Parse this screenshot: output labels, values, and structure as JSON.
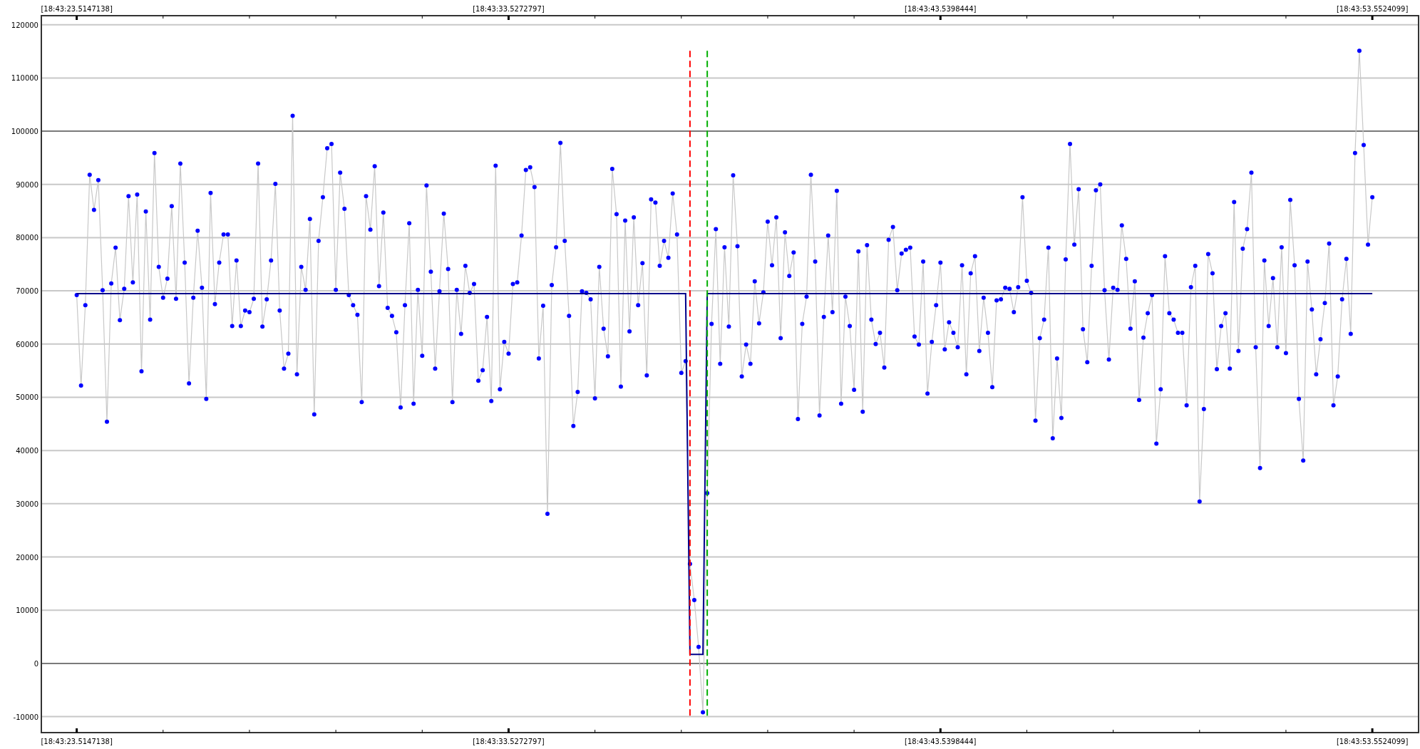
{
  "top_axis_labels": [
    "[18:43:23.5147138]",
    "[18:43:33.5272797]",
    "[18:43:43.5398444]",
    "[18:43:53.5524099]"
  ],
  "chart_data": {
    "type": "line",
    "grid": true,
    "ylim": [
      -13000,
      121700
    ],
    "categories": [
      "[18:43:23.5147138]",
      null,
      null,
      null,
      null,
      null,
      null,
      null,
      null,
      null,
      null,
      null,
      null,
      null,
      null,
      null,
      null,
      null,
      null,
      null,
      null,
      null,
      null,
      null,
      null,
      null,
      null,
      null,
      null,
      null,
      null,
      null,
      null,
      null,
      null,
      null,
      null,
      null,
      null,
      null,
      null,
      null,
      null,
      null,
      null,
      null,
      null,
      null,
      null,
      null,
      null,
      null,
      null,
      null,
      null,
      null,
      null,
      null,
      null,
      null,
      null,
      null,
      null,
      null,
      null,
      null,
      null,
      null,
      null,
      null,
      null,
      null,
      null,
      null,
      null,
      null,
      null,
      null,
      null,
      null,
      null,
      null,
      null,
      null,
      null,
      null,
      null,
      null,
      null,
      null,
      null,
      null,
      null,
      null,
      null,
      null,
      null,
      null,
      null,
      null,
      "[18:43:33.5272797]",
      null,
      null,
      null,
      null,
      null,
      null,
      null,
      null,
      null,
      null,
      null,
      null,
      null,
      null,
      null,
      null,
      null,
      null,
      null,
      null,
      null,
      null,
      null,
      null,
      null,
      null,
      null,
      null,
      null,
      null,
      null,
      null,
      null,
      null,
      null,
      null,
      null,
      null,
      null,
      null,
      null,
      null,
      null,
      null,
      null,
      null,
      null,
      null,
      null,
      null,
      null,
      null,
      null,
      null,
      null,
      null,
      null,
      null,
      null,
      null,
      null,
      null,
      null,
      null,
      null,
      null,
      null,
      null,
      null,
      null,
      null,
      null,
      null,
      null,
      null,
      null,
      null,
      null,
      null,
      null,
      null,
      null,
      null,
      null,
      null,
      null,
      null,
      null,
      null,
      null,
      null,
      null,
      null,
      null,
      null,
      null,
      null,
      null,
      null,
      "[18:43:43.5398444]",
      null,
      null,
      null,
      null,
      null,
      null,
      null,
      null,
      null,
      null,
      null,
      null,
      null,
      null,
      null,
      null,
      null,
      null,
      null,
      null,
      null,
      null,
      null,
      null,
      null,
      null,
      null,
      null,
      null,
      null,
      null,
      null,
      null,
      null,
      null,
      null,
      null,
      null,
      null,
      null,
      null,
      null,
      null,
      null,
      null,
      null,
      null,
      null,
      null,
      null,
      null,
      null,
      null,
      null,
      null,
      null,
      null,
      null,
      null,
      null,
      null,
      null,
      null,
      null,
      null,
      null,
      null,
      null,
      null,
      null,
      null,
      null,
      null,
      null,
      null,
      null,
      null,
      null,
      null,
      null,
      null,
      null,
      null,
      null,
      null,
      null,
      null,
      null,
      null,
      null,
      null,
      null,
      null,
      null,
      null,
      null,
      null,
      null,
      null,
      "[18:43:53.5524099]"
    ],
    "yticks": [
      -10000,
      0,
      10000,
      20000,
      30000,
      40000,
      50000,
      60000,
      70000,
      80000,
      90000,
      100000,
      110000,
      120000
    ],
    "series": [
      {
        "color": "#0000ff",
        "marker": "circle",
        "values": [
          69200,
          52200,
          67300,
          91800,
          85200,
          90800,
          70100,
          45400,
          71400,
          78100,
          64500,
          70400,
          87800,
          71600,
          88100,
          54900,
          84900,
          64600,
          95900,
          74500,
          68700,
          72300,
          85900,
          68500,
          93900,
          75300,
          52600,
          68700,
          81300,
          70600,
          49700,
          88400,
          67500,
          75300,
          80600,
          80600,
          63400,
          75700,
          63400,
          66300,
          66000,
          68500,
          93900,
          63300,
          68400,
          75700,
          90100,
          66300,
          55400,
          58200,
          102900,
          54300,
          74500,
          70200,
          83500,
          46800,
          79400,
          87600,
          96800,
          97600,
          70200,
          92200,
          85400,
          69200,
          67300,
          65500,
          49100,
          87800,
          81500,
          93400,
          70900,
          84700,
          66800,
          65300,
          62200,
          48100,
          67300,
          82700,
          48800,
          70200,
          57800,
          89800,
          73600,
          55400,
          69900,
          84500,
          74100,
          49100,
          70200,
          61900,
          74700,
          69600,
          71300,
          53100,
          55100,
          65100,
          49300,
          93500,
          51500,
          60400,
          58200,
          71300,
          71600,
          80400,
          92700,
          93200,
          89500,
          57300,
          67200,
          28100,
          71100,
          78200,
          97800,
          79400,
          65300,
          44600,
          51000,
          69900,
          69600,
          68400,
          49800,
          74500,
          62900,
          57700,
          92900,
          84400,
          52000,
          83200,
          62400,
          83800,
          67300,
          75200,
          54100,
          87200,
          86600,
          74700,
          79400,
          76200,
          88300,
          80600,
          54600,
          56800,
          18700,
          11900,
          3100,
          -9200,
          32000,
          63800,
          81600,
          56300,
          78200,
          63300,
          91700,
          78400,
          53900,
          59900,
          56300,
          71800,
          63900,
          69700,
          83000,
          74800,
          83800,
          61100,
          81000,
          72800,
          77200,
          45900,
          63800,
          68900,
          91800,
          75500,
          46600,
          65100,
          80400,
          66000,
          88800,
          48800,
          68900,
          63400,
          51400,
          77400,
          47300,
          78600,
          64600,
          60000,
          62100,
          55600,
          79600,
          82000,
          70100,
          77000,
          77700,
          78100,
          61400,
          59900,
          75500,
          50700,
          60400,
          67300,
          75300,
          59000,
          64100,
          62100,
          59400,
          74800,
          54300,
          73300,
          76500,
          58700,
          68700,
          62100,
          51900,
          68200,
          68400,
          70600,
          70400,
          66000,
          70700,
          87600,
          71900,
          69600,
          45600,
          61100,
          64600,
          78100,
          42300,
          57300,
          46100,
          75900,
          97600,
          78700,
          89100,
          62800,
          56600,
          74700,
          88900,
          90000,
          70100,
          57100,
          70600,
          70200,
          82300,
          76000,
          62900,
          71800,
          49500,
          61200,
          65800,
          69200,
          41300,
          51500,
          76500,
          65800,
          64600,
          62100,
          62100,
          48500,
          70700,
          74700,
          30400,
          47800,
          76900,
          73300,
          55300,
          63400,
          65800,
          55400,
          86700,
          58700,
          77900,
          81600,
          92200,
          59400,
          36700,
          75700,
          63400,
          72400,
          59400,
          78200,
          58300,
          87100,
          74800,
          49700,
          38100,
          75500,
          66500,
          54300,
          60900,
          67700,
          78900,
          48500,
          53900,
          68400,
          76000,
          61900,
          95900,
          115100,
          97400,
          78700,
          87600
        ]
      },
      {
        "color": "#00008b",
        "values": [
          69500,
          69500,
          69500,
          69500,
          69500,
          69500,
          69500,
          69500,
          69500,
          69500,
          69500,
          69500,
          69500,
          69500,
          69500,
          69500,
          69500,
          69500,
          69500,
          69500,
          69500,
          69500,
          69500,
          69500,
          69500,
          69500,
          69500,
          69500,
          69500,
          69500,
          69500,
          69500,
          69500,
          69500,
          69500,
          69500,
          69500,
          69500,
          69500,
          69500,
          69500,
          69500,
          69500,
          69500,
          69500,
          69500,
          69500,
          69500,
          69500,
          69500,
          69500,
          69500,
          69500,
          69500,
          69500,
          69500,
          69500,
          69500,
          69500,
          69500,
          69500,
          69500,
          69500,
          69500,
          69500,
          69500,
          69500,
          69500,
          69500,
          69500,
          69500,
          69500,
          69500,
          69500,
          69500,
          69500,
          69500,
          69500,
          69500,
          69500,
          69500,
          69500,
          69500,
          69500,
          69500,
          69500,
          69500,
          69500,
          69500,
          69500,
          69500,
          69500,
          69500,
          69500,
          69500,
          69500,
          69500,
          69500,
          69500,
          69500,
          69500,
          69500,
          69500,
          69500,
          69500,
          69500,
          69500,
          69500,
          69500,
          69500,
          69500,
          69500,
          69500,
          69500,
          69500,
          69500,
          69500,
          69500,
          69500,
          69500,
          69500,
          69500,
          69500,
          69500,
          69500,
          69500,
          69500,
          69500,
          69500,
          69500,
          69500,
          69500,
          69500,
          69500,
          69500,
          69500,
          69500,
          69500,
          69500,
          69500,
          69500,
          69500,
          1700,
          1700,
          1700,
          1700,
          69500,
          69500,
          69500,
          69500,
          69500,
          69500,
          69500,
          69500,
          69500,
          69500,
          69500,
          69500,
          69500,
          69500,
          69500,
          69500,
          69500,
          69500,
          69500,
          69500,
          69500,
          69500,
          69500,
          69500,
          69500,
          69500,
          69500,
          69500,
          69500,
          69500,
          69500,
          69500,
          69500,
          69500,
          69500,
          69500,
          69500,
          69500,
          69500,
          69500,
          69500,
          69500,
          69500,
          69500,
          69500,
          69500,
          69500,
          69500,
          69500,
          69500,
          69500,
          69500,
          69500,
          69500,
          69500,
          69500,
          69500,
          69500,
          69500,
          69500,
          69500,
          69500,
          69500,
          69500,
          69500,
          69500,
          69500,
          69500,
          69500,
          69500,
          69500,
          69500,
          69500,
          69500,
          69500,
          69500,
          69500,
          69500,
          69500,
          69500,
          69500,
          69500,
          69500,
          69500,
          69500,
          69500,
          69500,
          69500,
          69500,
          69500,
          69500,
          69500,
          69500,
          69500,
          69500,
          69500,
          69500,
          69500,
          69500,
          69500,
          69500,
          69500,
          69500,
          69500,
          69500,
          69500,
          69500,
          69500,
          69500,
          69500,
          69500,
          69500,
          69500,
          69500,
          69500,
          69500,
          69500,
          69500,
          69500,
          69500,
          69500,
          69500,
          69500,
          69500,
          69500,
          69500,
          69500,
          69500,
          69500,
          69500,
          69500,
          69500,
          69500,
          69500,
          69500,
          69500,
          69500,
          69500,
          69500,
          69500,
          69500,
          69500,
          69500,
          69500,
          69500,
          69500,
          69500,
          69500,
          69500,
          69500,
          69500,
          69500,
          69500,
          69500,
          69500
        ]
      }
    ]
  }
}
